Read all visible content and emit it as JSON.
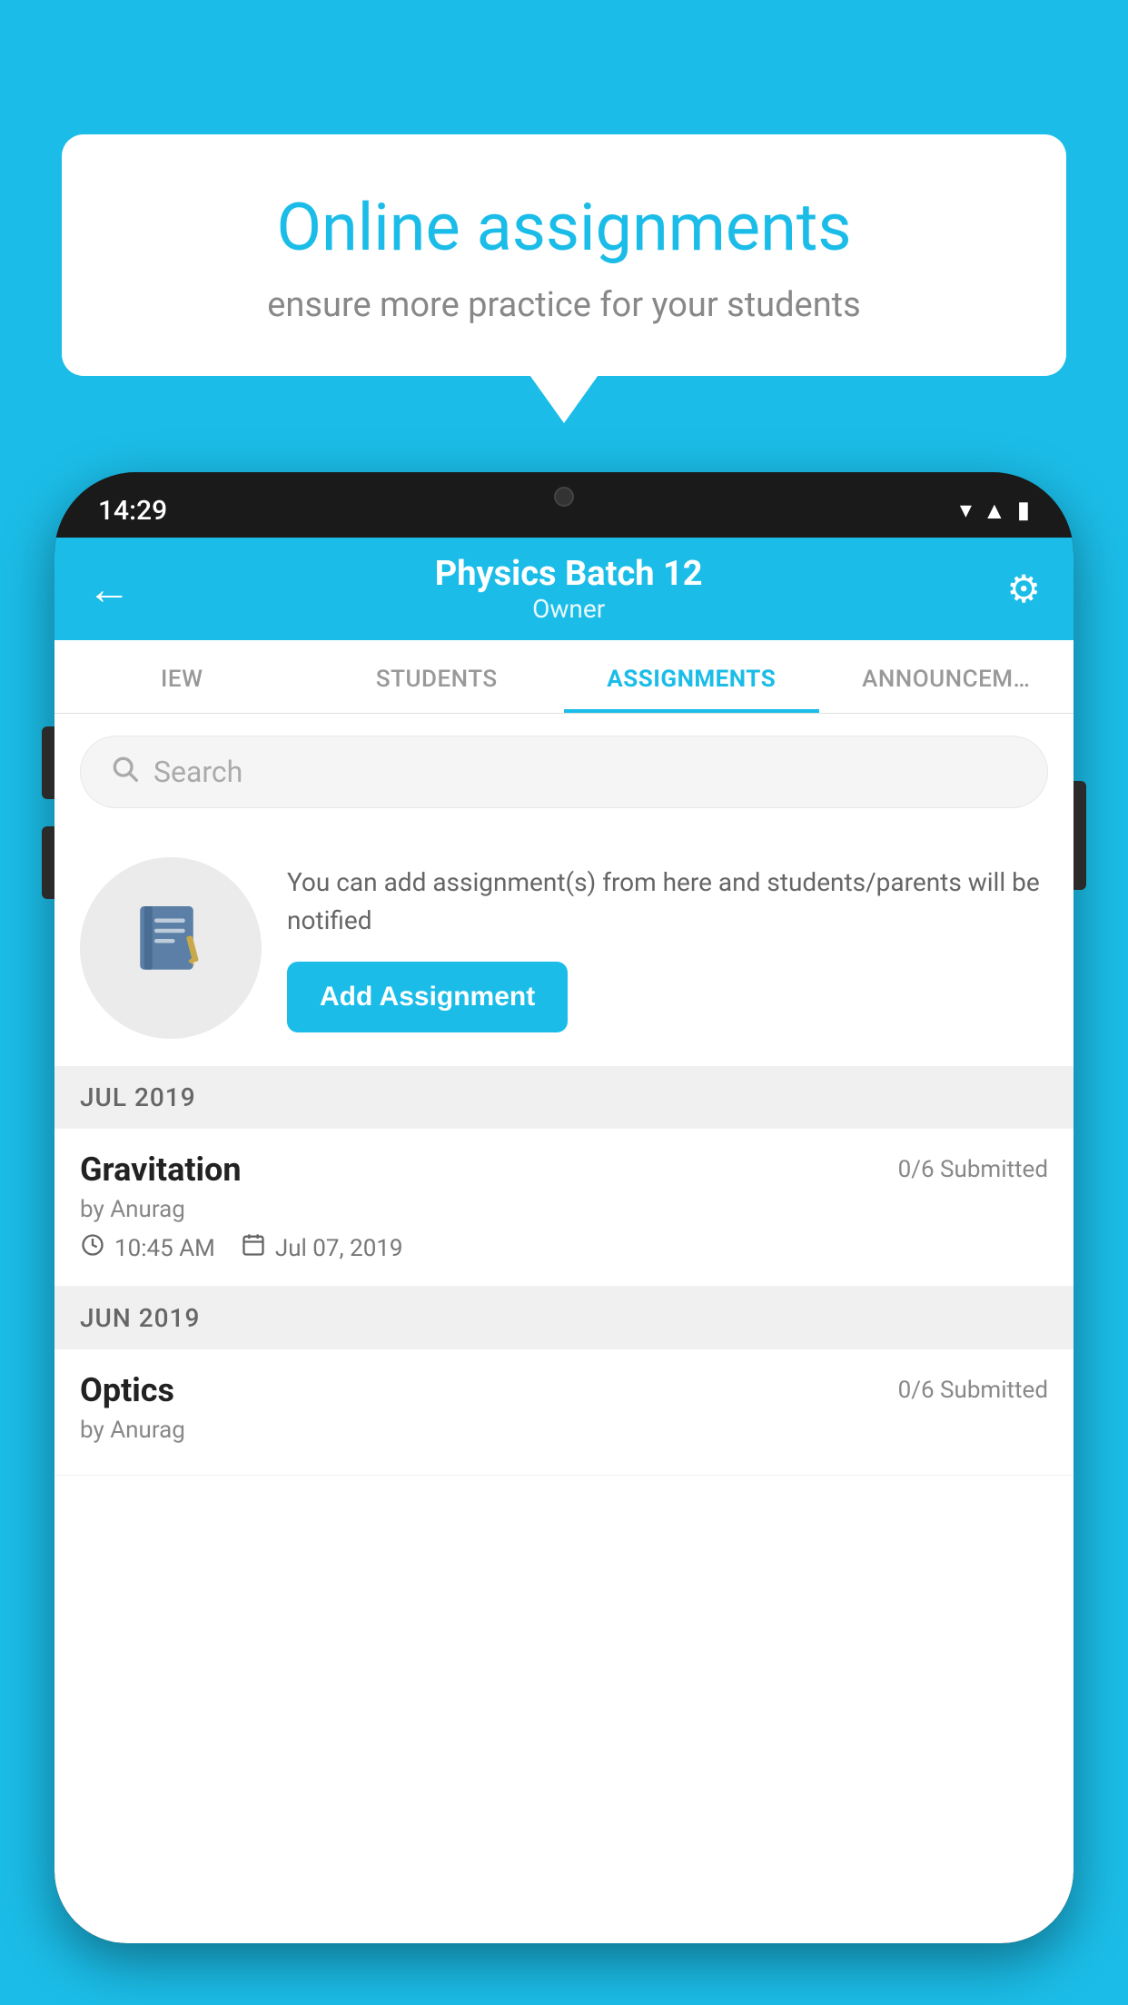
{
  "background_color": "#1BBDE8",
  "speech_bubble": {
    "title": "Online assignments",
    "subtitle": "ensure more practice for your students"
  },
  "phone": {
    "status_bar": {
      "time": "14:29"
    },
    "header": {
      "title": "Physics Batch 12",
      "subtitle": "Owner",
      "back_icon": "←",
      "settings_icon": "⚙"
    },
    "tabs": [
      {
        "label": "IEW",
        "active": false
      },
      {
        "label": "STUDENTS",
        "active": false
      },
      {
        "label": "ASSIGNMENTS",
        "active": true
      },
      {
        "label": "ANNOUNCEM…",
        "active": false
      }
    ],
    "search": {
      "placeholder": "Search"
    },
    "info_section": {
      "description": "You can add assignment(s) from here and students/parents will be notified",
      "button_label": "Add Assignment"
    },
    "assignment_groups": [
      {
        "month_label": "JUL 2019",
        "assignments": [
          {
            "name": "Gravitation",
            "submitted": "0/6 Submitted",
            "by": "by Anurag",
            "time": "10:45 AM",
            "date": "Jul 07, 2019"
          }
        ]
      },
      {
        "month_label": "JUN 2019",
        "assignments": [
          {
            "name": "Optics",
            "submitted": "0/6 Submitted",
            "by": "by Anurag",
            "time": "",
            "date": ""
          }
        ]
      }
    ]
  }
}
